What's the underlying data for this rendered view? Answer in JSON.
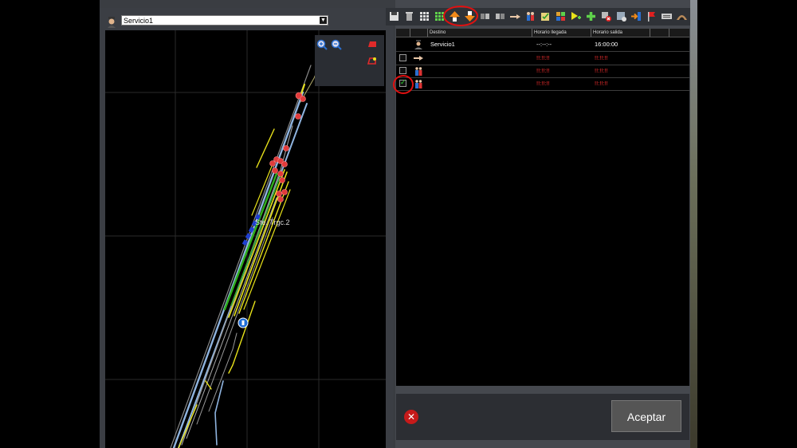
{
  "service_bar": {
    "selected": "Servicio1",
    "arrow": "▼"
  },
  "map": {
    "label": "Ste. Trgc.2",
    "controls": [
      "zoom-in-icon",
      "zoom-out-icon",
      "camera-icon",
      "pin-camera-icon"
    ]
  },
  "toolbar": {
    "icons": [
      "save-icon",
      "trash-icon",
      "grid-icon",
      "grid-green-icon",
      "move-up-icon",
      "move-down-icon",
      "split-left-icon",
      "split-right-icon",
      "hand-point-icon",
      "passengers-icon",
      "check-list-icon",
      "people-group-icon",
      "add-yellow-icon",
      "add-green-icon",
      "remove-red-icon",
      "add-window-icon",
      "arrow-in-icon",
      "flag-icon",
      "keyboard-icon",
      "tunnel-icon"
    ]
  },
  "table": {
    "headers": [
      "Destino",
      "Horario llegada",
      "Horario salida"
    ],
    "rows": [
      {
        "icon": "driver-icon",
        "checkbox": null,
        "destino": "Servicio1",
        "llegada": "--:--:--",
        "salida": "16:00:00",
        "red": false
      },
      {
        "icon": "hand-point-icon",
        "checkbox": false,
        "destino": "",
        "llegada": "!!:!!:!!",
        "salida": "!!:!!:!!",
        "red": true
      },
      {
        "icon": "passengers-icon",
        "checkbox": false,
        "destino": "",
        "llegada": "!!:!!:!!",
        "salida": "!!:!!:!!",
        "red": true
      },
      {
        "icon": "passengers-icon",
        "checkbox": true,
        "destino": "",
        "llegada": "!!:!!:!!",
        "salida": "!!:!!:!!",
        "red": true
      }
    ]
  },
  "bottom": {
    "accept_label": "Aceptar"
  },
  "colors": {
    "highlight": "#e01010",
    "accent_red": "#ff3030",
    "track_green": "#2fae1d",
    "track_yellow": "#e8e21a",
    "track_blue": "#7fb3e8"
  }
}
